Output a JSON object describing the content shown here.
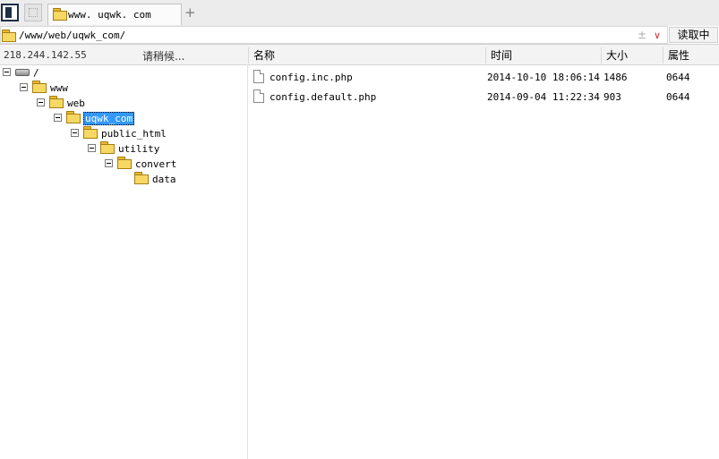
{
  "tabs": [
    {
      "label": "www. uqwk. com"
    }
  ],
  "add_tab_label": "+",
  "address": {
    "path": "/www/web/uqwk_com/",
    "plusminus": "±",
    "dropdown": "∨",
    "read_button": "读取中"
  },
  "status": {
    "ip": "218.244.142.55",
    "wait": "请稍候..."
  },
  "columns": {
    "name": "名称",
    "time": "时间",
    "size": "大小",
    "attr": "属性"
  },
  "tree": {
    "root": "/",
    "nodes": [
      {
        "label": "www"
      },
      {
        "label": "web"
      },
      {
        "label": "uqwk_com"
      },
      {
        "label": "public_html"
      },
      {
        "label": "utility"
      },
      {
        "label": "convert"
      },
      {
        "label": "data"
      }
    ]
  },
  "files": [
    {
      "name": "config.inc.php",
      "time": "2014-10-10 18:06:14",
      "size": "1486",
      "attr": "0644"
    },
    {
      "name": "config.default.php",
      "time": "2014-09-04 11:22:34",
      "size": "903",
      "attr": "0644"
    }
  ]
}
